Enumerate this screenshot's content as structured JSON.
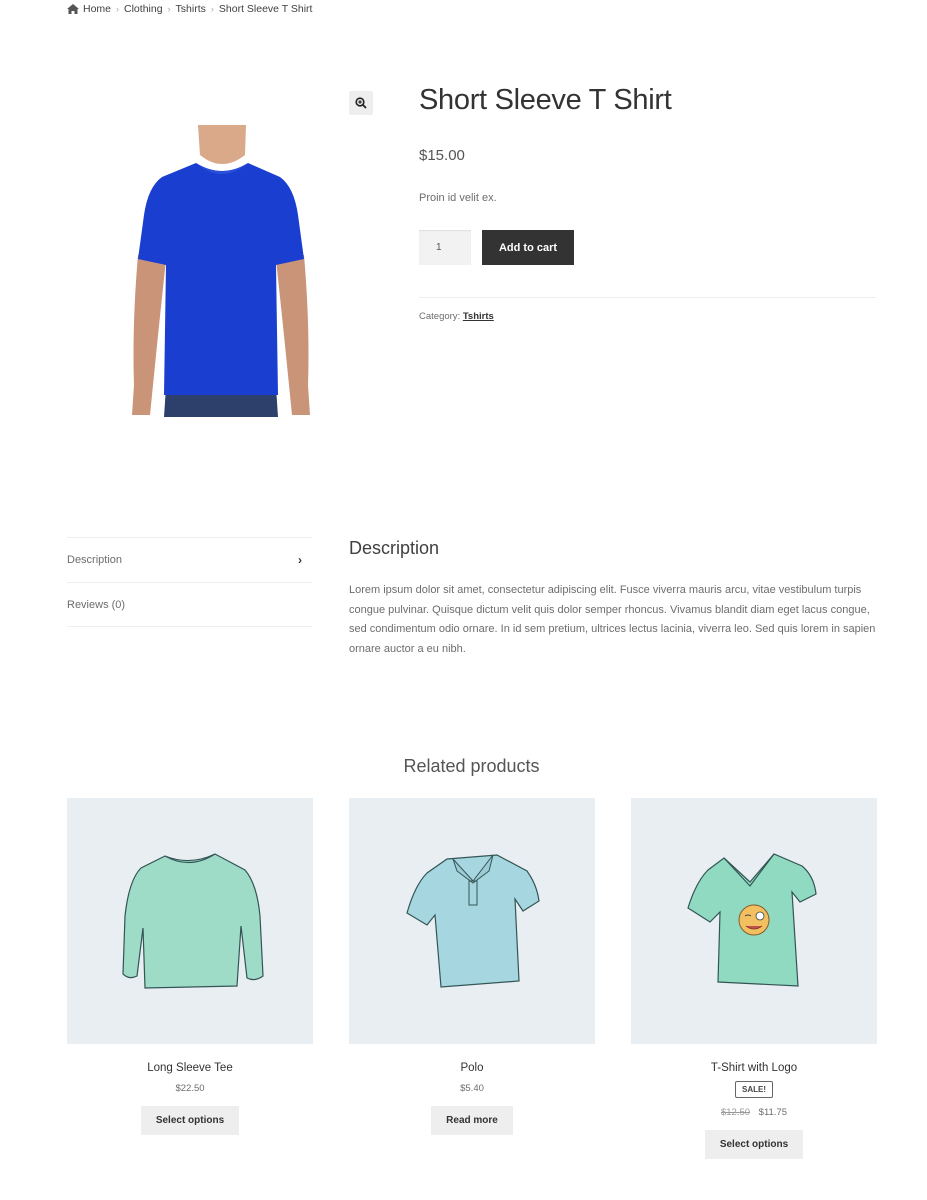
{
  "breadcrumb": {
    "icon": "home-icon",
    "items": [
      "Home",
      "Clothing",
      "Tshirts",
      "Short Sleeve T Shirt"
    ],
    "separator": "›"
  },
  "product": {
    "title": "Short Sleeve T Shirt",
    "price": "$15.00",
    "short_description": "Proin id velit ex.",
    "quantity": "1",
    "add_to_cart_label": "Add to cart",
    "category_label": "Category:",
    "category_value": "Tshirts",
    "zoom_icon": "zoom-in-icon",
    "image_colors": {
      "shirt": "#1a3fd0",
      "skin": "#d9a98a",
      "jeans": "#2d3f6b"
    }
  },
  "tabs": [
    {
      "label": "Description",
      "active": true,
      "icon": "chevron-right-icon"
    },
    {
      "label": "Reviews (0)",
      "active": false
    }
  ],
  "description": {
    "title": "Description",
    "body": "Lorem ipsum dolor sit amet, consectetur adipiscing elit. Fusce viverra mauris arcu, vitae vestibulum turpis congue pulvinar. Quisque dictum velit quis dolor semper rhoncus. Vivamus blandit diam eget lacus congue, sed condimentum odio ornare. In id sem pretium, ultrices lectus lacinia, viverra leo. Sed quis lorem in sapien ornare auctor a eu nibh."
  },
  "related": {
    "title": "Related products",
    "products": [
      {
        "name": "Long Sleeve Tee",
        "price": "$22.50",
        "button": "Select options",
        "color": "#9fdcc8"
      },
      {
        "name": "Polo",
        "price": "$5.40",
        "button": "Read more",
        "color": "#a6d6e0"
      },
      {
        "name": "T-Shirt with Logo",
        "badge": "SALE!",
        "old_price": "$12.50",
        "price": "$11.75",
        "button": "Select options",
        "color": "#8fdac0"
      }
    ]
  }
}
